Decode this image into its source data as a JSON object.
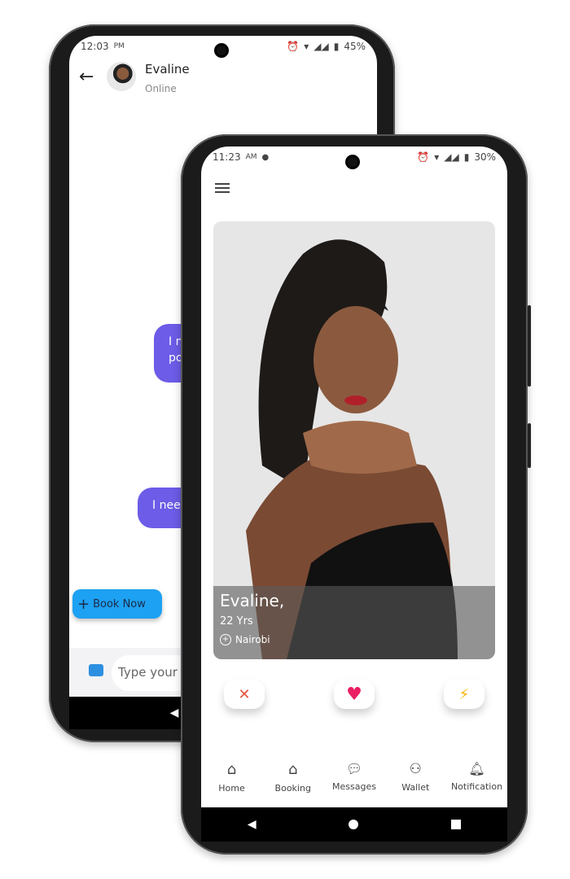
{
  "back_phone": {
    "status": {
      "time": "12:03",
      "ampm": "PM",
      "battery": "45%"
    },
    "chat_header": {
      "name": "Evaline",
      "presence": "Online"
    },
    "messages": [
      {
        "lines": [
          "I n",
          "po"
        ]
      },
      {
        "lines": [
          "I nee"
        ]
      }
    ],
    "book_now_label": "Book Now",
    "composer": {
      "placeholder": "Type your"
    },
    "bubble_color": "#6c5ce7",
    "book_color": "#1da1f2"
  },
  "front_phone": {
    "status": {
      "time": "11:23",
      "ampm": "AM",
      "battery": "30%"
    },
    "profile": {
      "name": "Evaline,",
      "age": "22 Yrs",
      "location": "Nairobi"
    },
    "actions": [
      {
        "icon": "close-icon",
        "glyph": "✕",
        "color": "#e5533d"
      },
      {
        "icon": "heart-icon",
        "glyph": "♥",
        "color": "#e91e63"
      },
      {
        "icon": "lightning-icon",
        "glyph": "⚡",
        "color": "#f5b301"
      }
    ],
    "tabs": [
      {
        "label": "Home",
        "icon": "home-icon"
      },
      {
        "label": "Booking",
        "icon": "home-icon"
      },
      {
        "label": "Messages",
        "icon": "chat-icon"
      },
      {
        "label": "Wallet",
        "icon": "user-icon"
      },
      {
        "label": "Notification",
        "icon": "bell-icon"
      }
    ]
  }
}
